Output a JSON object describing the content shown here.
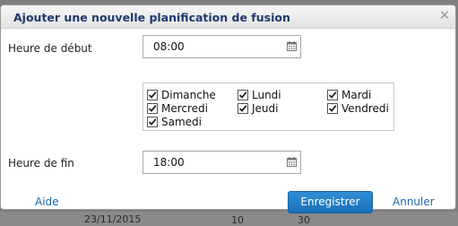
{
  "background": {
    "text1": "23/11/2015",
    "text2": "10",
    "text3": "30"
  },
  "dialog": {
    "title": "Ajouter une nouvelle planification de fusion",
    "close_icon": "close-icon",
    "start_label": "Heure de début",
    "start_value": "08:00",
    "end_label": "Heure de fin",
    "end_value": "18:00",
    "calendar_icon": "calendar-icon",
    "days": [
      {
        "label": "Dimanche",
        "checked": true
      },
      {
        "label": "Lundi",
        "checked": true
      },
      {
        "label": "Mardi",
        "checked": true
      },
      {
        "label": "Mercredi",
        "checked": true
      },
      {
        "label": "Jeudi",
        "checked": true
      },
      {
        "label": "Vendredi",
        "checked": true
      },
      {
        "label": "Samedi",
        "checked": true
      }
    ],
    "help_label": "Aide",
    "save_label": "Enregistrer",
    "cancel_label": "Annuler"
  },
  "colors": {
    "title": "#1d3a6b",
    "link": "#1a66b3",
    "primary_button": "#1f78c4"
  }
}
